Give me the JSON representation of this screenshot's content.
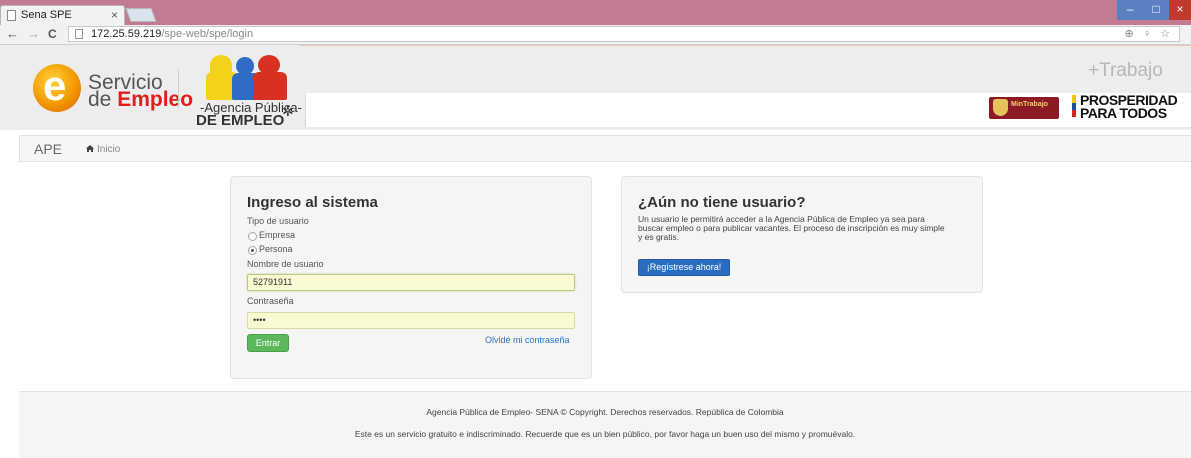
{
  "browser": {
    "tab_title": "Sena SPE",
    "tab_close": "×",
    "url_host": "172.25.59.219",
    "url_path": "/spe-web/spe/login",
    "url_right_icons": "⊕ ♀ ☆",
    "back": "←",
    "forward": "→",
    "reload": "C",
    "win_min": "–",
    "win_max": "□",
    "win_close": "×"
  },
  "header": {
    "logo_text_1": "Servicio",
    "logo_text_2a": "de ",
    "logo_text_2b": "Empleo",
    "logo_letter": "e",
    "agencia_line_1": "-Agencia Pública-",
    "agencia_line_2": "DE EMPLEO",
    "trabajo": "+Trabajo",
    "mintrabajo": "MinTrabajo",
    "prosperidad_1": "PROSPERIDAD",
    "prosperidad_2": "PARA TODOS"
  },
  "breadcrumb": {
    "brand": "APE",
    "home": "Inicio"
  },
  "login": {
    "title": "Ingreso al sistema",
    "user_type_label": "Tipo de usuario",
    "option_empresa": "Empresa",
    "option_persona": "Persona",
    "selected": "Persona",
    "username_label": "Nombre de usuario",
    "username_value": "52791911",
    "password_label": "Contraseña",
    "password_value": "••••",
    "submit_label": "Entrar",
    "forgot_label": "Olvidé mi contraseña"
  },
  "register": {
    "title": "¿Aún no tiene usuario?",
    "line_1": "Un usuario le permitirá acceder a la Agencia Pública de Empleo ya sea para",
    "line_2": "buscar empleo o para publicar vacantes. El proceso de inscripción es muy simple",
    "line_3": "y es gratis.",
    "button_label": "¡Regístrese ahora!"
  },
  "footer": {
    "line_1": "Agencia Pública de Empleo- SENA © Copyright. Derechos reservados. República de Colombia",
    "line_2": "Este es un servicio gratuito e indiscriminado. Recuerde que es un bien público, por favor haga un buen uso del mismo y promuévalo."
  },
  "colors": {
    "titlebar": "#c27c92",
    "accent_green": "#5cb85c",
    "accent_blue": "#2a6cc0",
    "link": "#2a74c4",
    "brand_red": "#e31d1d"
  }
}
